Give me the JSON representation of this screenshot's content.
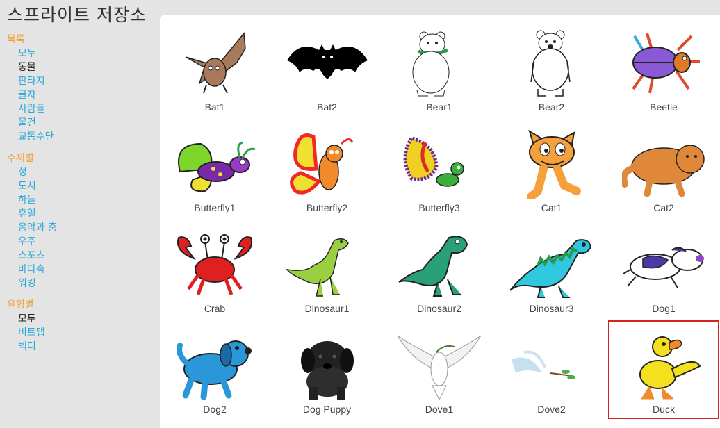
{
  "title": "스프라이트 저장소",
  "sidebar": {
    "sections": [
      {
        "heading": "목록",
        "items": [
          {
            "label": "모두",
            "selected": false
          },
          {
            "label": "동물",
            "selected": true
          },
          {
            "label": "판타지",
            "selected": false
          },
          {
            "label": "글자",
            "selected": false
          },
          {
            "label": "사람들",
            "selected": false
          },
          {
            "label": "물건",
            "selected": false
          },
          {
            "label": "교통수단",
            "selected": false
          }
        ]
      },
      {
        "heading": "주제별",
        "items": [
          {
            "label": "성",
            "selected": false
          },
          {
            "label": "도시",
            "selected": false
          },
          {
            "label": "하늘",
            "selected": false
          },
          {
            "label": "휴일",
            "selected": false
          },
          {
            "label": "음악과 춤",
            "selected": false
          },
          {
            "label": "우주",
            "selected": false
          },
          {
            "label": "스포츠",
            "selected": false
          },
          {
            "label": "바다속",
            "selected": false
          },
          {
            "label": "워킹",
            "selected": false
          }
        ]
      },
      {
        "heading": "유형별",
        "items": [
          {
            "label": "모두",
            "selected": true
          },
          {
            "label": "비트맵",
            "selected": false
          },
          {
            "label": "벡터",
            "selected": false
          }
        ]
      }
    ]
  },
  "sprites": [
    {
      "name": "Bat1",
      "icon": "bat1-icon",
      "color": "#a8795a"
    },
    {
      "name": "Bat2",
      "icon": "bat2-icon",
      "color": "#000000"
    },
    {
      "name": "Bear1",
      "icon": "bear1-icon",
      "color": "#ffffff"
    },
    {
      "name": "Bear2",
      "icon": "bear2-icon",
      "color": "#ffffff"
    },
    {
      "name": "Beetle",
      "icon": "beetle-icon",
      "color": "#8a5ad6"
    },
    {
      "name": "Butterfly1",
      "icon": "butterfly1-icon",
      "color": "#7ed62a"
    },
    {
      "name": "Butterfly2",
      "icon": "butterfly2-icon",
      "color": "#f02828"
    },
    {
      "name": "Butterfly3",
      "icon": "butterfly3-icon",
      "color": "#f0d020"
    },
    {
      "name": "Cat1",
      "icon": "cat1-icon",
      "color": "#f5a03a"
    },
    {
      "name": "Cat2",
      "icon": "cat2-icon",
      "color": "#e0883a"
    },
    {
      "name": "Crab",
      "icon": "crab-icon",
      "color": "#e02020"
    },
    {
      "name": "Dinosaur1",
      "icon": "dinosaur1-icon",
      "color": "#9ad040"
    },
    {
      "name": "Dinosaur2",
      "icon": "dinosaur2-icon",
      "color": "#2aa078"
    },
    {
      "name": "Dinosaur3",
      "icon": "dinosaur3-icon",
      "color": "#30c8e0"
    },
    {
      "name": "Dog1",
      "icon": "dog1-icon",
      "color": "#4a3aa8"
    },
    {
      "name": "Dog2",
      "icon": "dog2-icon",
      "color": "#2a98d8"
    },
    {
      "name": "Dog Puppy",
      "icon": "dog-puppy-icon",
      "color": "#222222"
    },
    {
      "name": "Dove1",
      "icon": "dove1-icon",
      "color": "#f2f2f2"
    },
    {
      "name": "Dove2",
      "icon": "dove2-icon",
      "color": "#b8d8ea"
    },
    {
      "name": "Duck",
      "icon": "duck-icon",
      "color": "#f5e020",
      "selected": true
    }
  ],
  "colors": {
    "accent": "#2aa8d8",
    "section_heading": "#f0a030",
    "selection": "#d92020"
  }
}
